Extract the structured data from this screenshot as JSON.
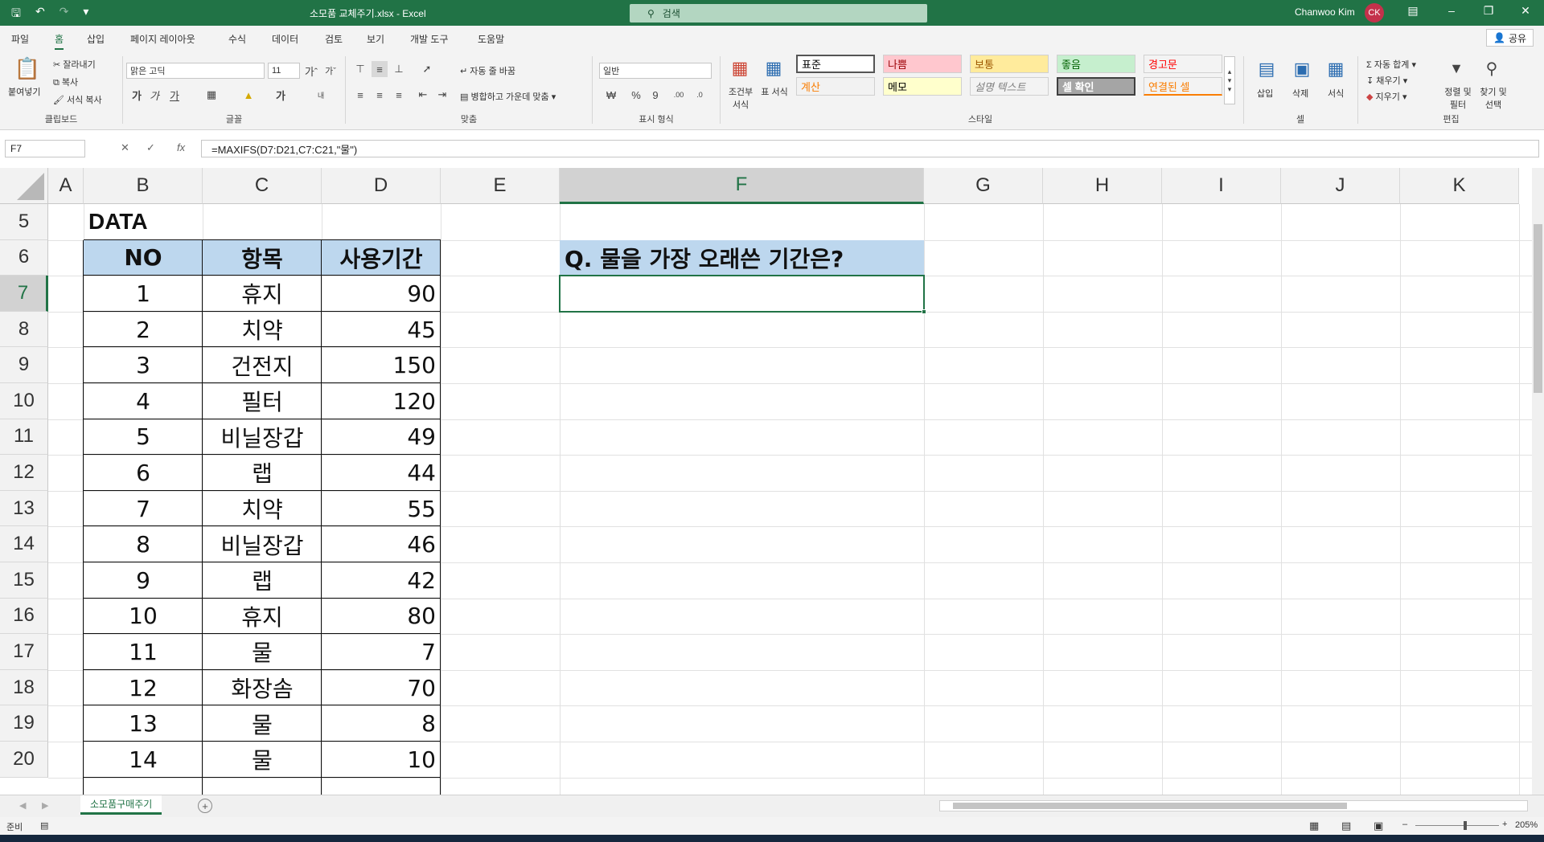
{
  "window": {
    "doc_title": "소모품 교체주기.xlsx  -  Excel",
    "search_placeholder": "검색",
    "user_name": "Chanwoo Kim",
    "user_initials": "CK"
  },
  "menu": {
    "tabs": [
      "파일",
      "홈",
      "삽입",
      "페이지 레이아웃",
      "수식",
      "데이터",
      "검토",
      "보기",
      "개발 도구",
      "도움말"
    ],
    "active": "홈",
    "share_label": "공유"
  },
  "ribbon": {
    "clipboard": {
      "paste": "붙여넣기",
      "cut": "잘라내기",
      "copy": "복사",
      "format_painter": "서식 복사",
      "label": "클립보드"
    },
    "font": {
      "name": "맑은 고딕",
      "size": "11",
      "label": "글꼴"
    },
    "alignment": {
      "wrap": "자동 줄 바꿈",
      "merge": "병합하고 가운데 맞춤",
      "label": "맞춤"
    },
    "number": {
      "format": "일반",
      "label": "표시 형식"
    },
    "styles": {
      "conditional": "조건부 서식",
      "table": "표 서식",
      "cells": [
        {
          "label": "표준",
          "bg": "#ffffff",
          "fg": "#000000"
        },
        {
          "label": "나쁨",
          "bg": "#ffc7ce",
          "fg": "#9c0006"
        },
        {
          "label": "보통",
          "bg": "#ffeb9c",
          "fg": "#9c5700"
        },
        {
          "label": "좋음",
          "bg": "#c6efce",
          "fg": "#006100"
        },
        {
          "label": "경고문",
          "bg": "#f3f3f3",
          "fg": "#ff0000"
        },
        {
          "label": "계산",
          "bg": "#f2f2f2",
          "fg": "#fa7d00"
        },
        {
          "label": "메모",
          "bg": "#ffffcc",
          "fg": "#000000"
        },
        {
          "label": "설명 텍스트",
          "bg": "#f3f3f3",
          "fg": "#7f7f7f"
        },
        {
          "label": "셀 확인",
          "bg": "#a5a5a5",
          "fg": "#ffffff"
        },
        {
          "label": "연결된 셀",
          "bg": "#f3f3f3",
          "fg": "#fa7d00"
        }
      ],
      "label": "스타일"
    },
    "cells": {
      "insert": "삽입",
      "delete": "삭제",
      "format": "서식",
      "label": "셀"
    },
    "editing": {
      "autosum": "자동 합계",
      "fill": "채우기",
      "clear": "지우기",
      "sort": "정렬 및 필터",
      "find": "찾기 및 선택",
      "label": "편집"
    }
  },
  "formula_bar": {
    "name_box": "F7",
    "formula": "=MAXIFS(D7:D21,C7:C21,\"물\")"
  },
  "sheet": {
    "columns": [
      "A",
      "B",
      "C",
      "D",
      "E",
      "F",
      "G",
      "H",
      "I",
      "J",
      "K"
    ],
    "selected_col": "F",
    "selected_row": "7",
    "rows": [
      "5",
      "6",
      "7",
      "8",
      "9",
      "10",
      "11",
      "12",
      "13",
      "14",
      "15",
      "16",
      "17",
      "18",
      "19",
      "20"
    ],
    "title": "DATA",
    "headers": [
      "NO",
      "항목",
      "사용기간"
    ],
    "data": [
      [
        "1",
        "휴지",
        "90"
      ],
      [
        "2",
        "치약",
        "45"
      ],
      [
        "3",
        "건전지",
        "150"
      ],
      [
        "4",
        "필터",
        "120"
      ],
      [
        "5",
        "비닐장갑",
        "49"
      ],
      [
        "6",
        "랩",
        "44"
      ],
      [
        "7",
        "치약",
        "55"
      ],
      [
        "8",
        "비닐장갑",
        "46"
      ],
      [
        "9",
        "랩",
        "42"
      ],
      [
        "10",
        "휴지",
        "80"
      ],
      [
        "11",
        "물",
        "7"
      ],
      [
        "12",
        "화장솜",
        "70"
      ],
      [
        "13",
        "물",
        "8"
      ],
      [
        "14",
        "물",
        "10"
      ]
    ],
    "question": "Q. 물을 가장 오래쓴 기간은?",
    "header_fill": "#bdd7ee",
    "accent": "#217346"
  },
  "sheet_tab": "소모품구매주기",
  "status": {
    "ready": "준비",
    "zoom": "205%"
  }
}
